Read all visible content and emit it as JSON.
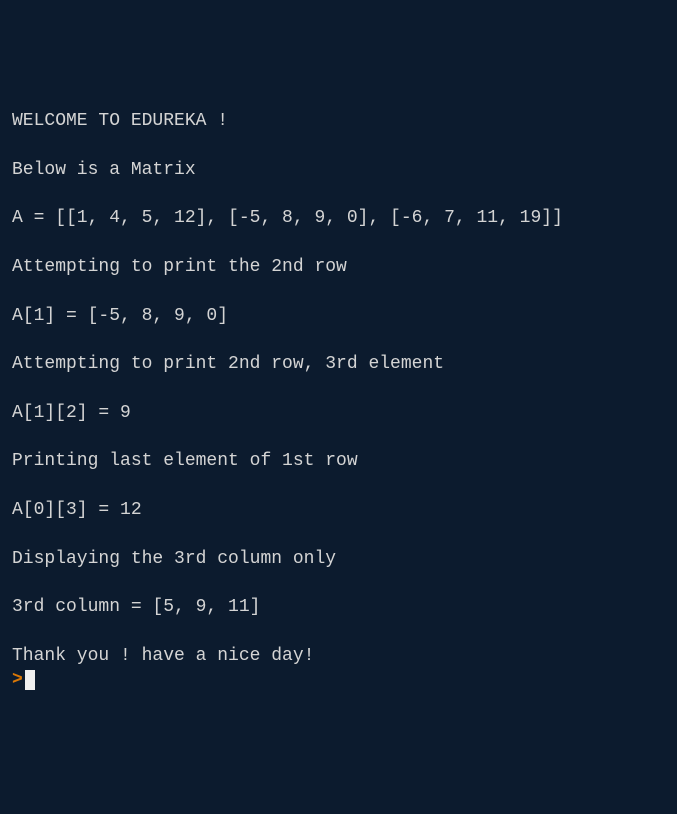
{
  "terminal": {
    "lines": [
      "WELCOME TO EDUREKA !",
      "",
      "Below is a Matrix",
      "",
      "A = [[1, 4, 5, 12], [-5, 8, 9, 0], [-6, 7, 11, 19]]",
      "",
      "Attempting to print the 2nd row",
      "",
      "A[1] = [-5, 8, 9, 0]",
      "",
      "Attempting to print 2nd row, 3rd element",
      "",
      "A[1][2] = 9",
      "",
      "Printing last element of 1st row",
      "",
      "A[0][3] = 12",
      "",
      "Displaying the 3rd column only",
      "",
      "3rd column = [5, 9, 11]",
      "",
      "Thank you ! have a nice day!"
    ],
    "prompt": ">"
  }
}
